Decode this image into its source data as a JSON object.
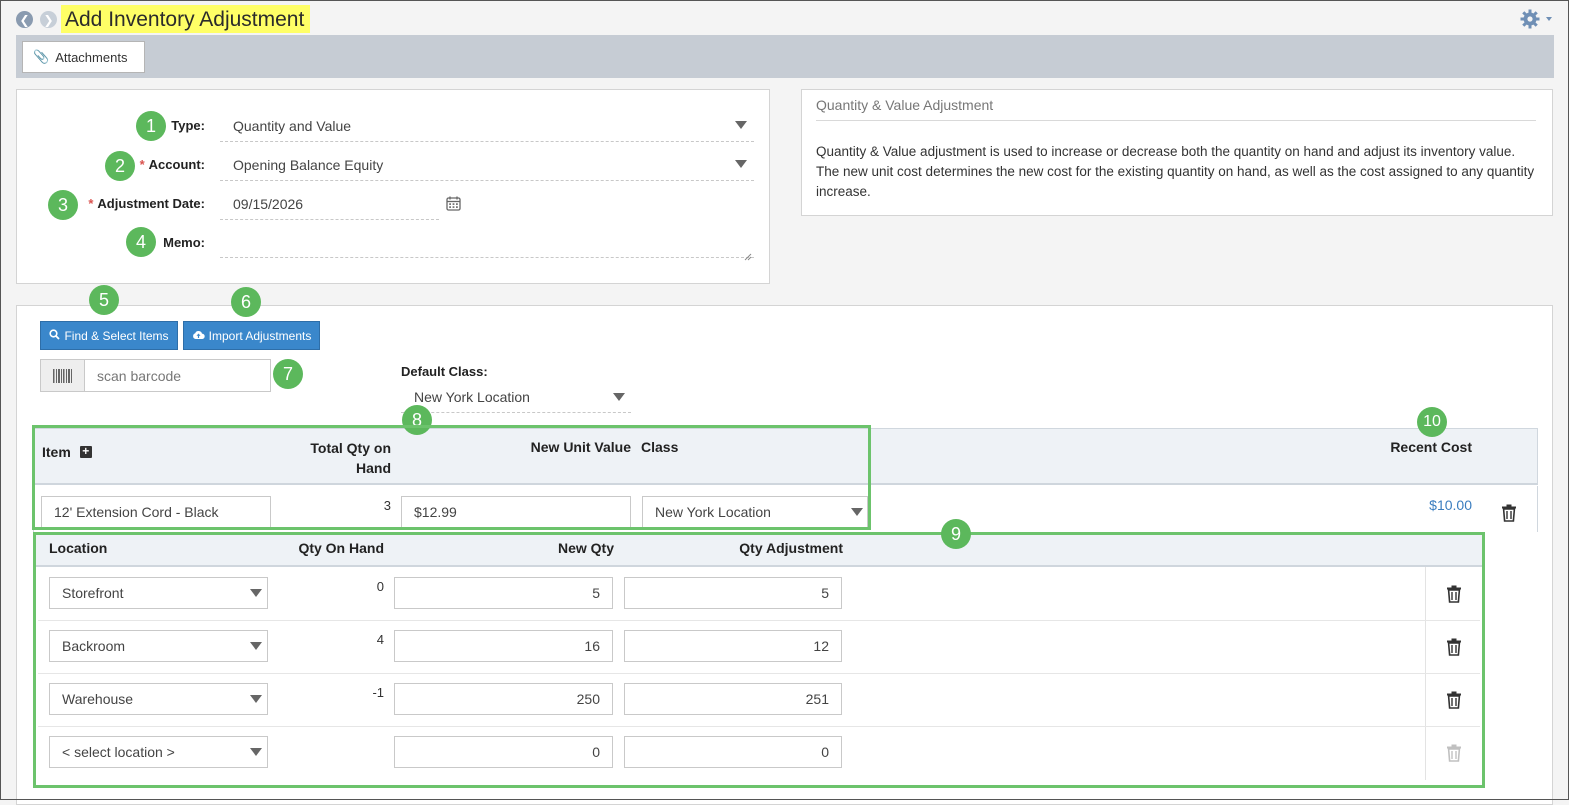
{
  "header": {
    "title": "Add Inventory Adjustment"
  },
  "toolbar": {
    "attachments_label": "Attachments"
  },
  "form": {
    "type_label": "Type:",
    "type_value": "Quantity and Value",
    "account_label": "Account:",
    "account_value": "Opening Balance Equity",
    "date_label": "Adjustment Date:",
    "date_value": "09/15/2026",
    "memo_label": "Memo:",
    "memo_value": ""
  },
  "info": {
    "title": "Quantity & Value Adjustment",
    "body": "Quantity & Value adjustment is used to increase or decrease both the quantity on hand and adjust its inventory value. The new unit cost determines the new cost for the existing quantity on hand, as well as the cost assigned to any quantity increase."
  },
  "actions": {
    "find_label": "Find & Select Items",
    "import_label": "Import Adjustments",
    "barcode_placeholder": "scan barcode"
  },
  "default_class": {
    "label": "Default Class:",
    "value": "New York Location"
  },
  "items_table": {
    "headers": {
      "item": "Item",
      "total_qty_line1": "Total Qty on",
      "total_qty_line2": "Hand",
      "new_unit_value": "New Unit Value",
      "class": "Class",
      "recent_cost": "Recent Cost"
    },
    "row": {
      "item": "12' Extension Cord - Black",
      "total_qty": "3",
      "new_unit_value": "$12.99",
      "class": "New York Location",
      "recent_cost": "$10.00"
    }
  },
  "locations_table": {
    "headers": {
      "location": "Location",
      "qty_on_hand": "Qty On Hand",
      "new_qty": "New Qty",
      "qty_adjustment": "Qty Adjustment"
    },
    "rows": [
      {
        "location": "Storefront",
        "qty_on_hand": "0",
        "new_qty": "5",
        "qty_adjustment": "5"
      },
      {
        "location": "Backroom",
        "qty_on_hand": "4",
        "new_qty": "16",
        "qty_adjustment": "12"
      },
      {
        "location": "Warehouse",
        "qty_on_hand": "-1",
        "new_qty": "250",
        "qty_adjustment": "251"
      },
      {
        "location": "< select location >",
        "qty_on_hand": "",
        "new_qty": "0",
        "qty_adjustment": "0"
      }
    ]
  },
  "callouts": [
    "1",
    "2",
    "3",
    "4",
    "5",
    "6",
    "7",
    "8",
    "9",
    "10"
  ],
  "colors": {
    "highlight": "#ffff66",
    "accent_blue": "#3a87cb",
    "callout_green": "#5cb85c",
    "link_blue": "#3a7dbf"
  }
}
